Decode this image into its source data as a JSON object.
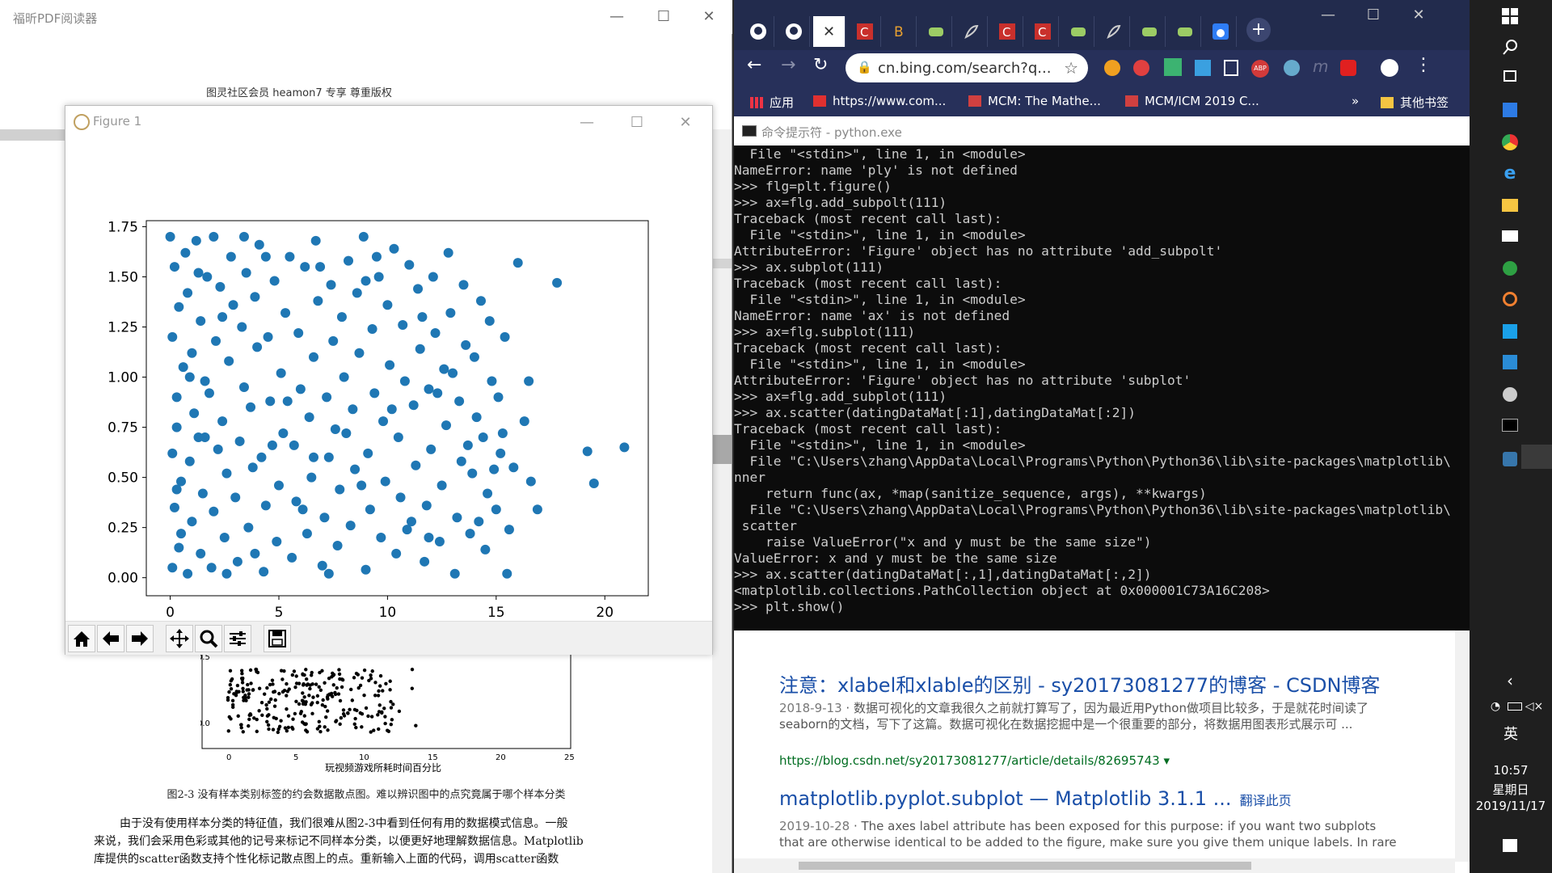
{
  "pdf": {
    "window_title": "福昕PDF阅读器",
    "page_header": "图灵社区会员 heamon7 专享 尊重版权",
    "figure_caption": "图2-3  没有样本类别标签的约会数据散点图。难以辨识图中的点究竟属于哪个样本分类",
    "body_lines": [
      "由于没有使用样本分类的特征值，我们很难从图2-3中看到任何有用的数据模式信息。一般",
      "来说，我们会采用色彩或其他的记号来标记不同样本分类，以便更好地理解数据信息。Matplotlib",
      "库提供的scatter函数支持个性化标记散点图上的点。重新输入上面的代码，调用scatter函数"
    ],
    "book_plot": {
      "ytick_labels": [
        "0.5",
        "0.0"
      ],
      "xtick_labels": [
        "0",
        "5",
        "10",
        "15",
        "20",
        "25"
      ],
      "xlabel": "玩视频游戏所耗时间百分比"
    }
  },
  "figure_window": {
    "title": "Figure 1",
    "toolbar": [
      "home-icon",
      "back-icon",
      "forward-icon",
      "pan-icon",
      "zoom-icon",
      "configure-icon",
      "save-icon"
    ]
  },
  "chart_data": {
    "type": "scatter",
    "color": "#1f77b4",
    "xlim": [
      -1.1,
      22
    ],
    "ylim": [
      -0.09,
      1.78
    ],
    "xticks": [
      0,
      5,
      10,
      15,
      20
    ],
    "yticks": [
      0.0,
      0.25,
      0.5,
      0.75,
      1.0,
      1.25,
      1.5,
      1.75
    ],
    "xtick_labels": [
      "0",
      "5",
      "10",
      "15",
      "20"
    ],
    "ytick_labels": [
      "0.00",
      "0.25",
      "0.50",
      "0.75",
      "1.00",
      "1.25",
      "1.50",
      "1.75"
    ],
    "points": [
      [
        0.1,
        0.05
      ],
      [
        0.2,
        0.35
      ],
      [
        0.1,
        0.62
      ],
      [
        0.3,
        0.9
      ],
      [
        0.1,
        1.2
      ],
      [
        0.2,
        1.55
      ],
      [
        0.0,
        1.7
      ],
      [
        0.4,
        0.15
      ],
      [
        0.5,
        0.48
      ],
      [
        0.3,
        0.75
      ],
      [
        0.6,
        1.05
      ],
      [
        0.4,
        1.35
      ],
      [
        0.7,
        1.62
      ],
      [
        0.8,
        0.02
      ],
      [
        1.0,
        0.28
      ],
      [
        0.9,
        0.58
      ],
      [
        1.1,
        0.82
      ],
      [
        1.0,
        1.12
      ],
      [
        0.8,
        1.42
      ],
      [
        1.2,
        1.68
      ],
      [
        1.4,
        0.12
      ],
      [
        1.5,
        0.42
      ],
      [
        1.3,
        0.7
      ],
      [
        1.6,
        0.98
      ],
      [
        1.4,
        1.28
      ],
      [
        1.7,
        1.5
      ],
      [
        1.9,
        0.05
      ],
      [
        2.0,
        0.33
      ],
      [
        2.2,
        0.64
      ],
      [
        1.8,
        0.92
      ],
      [
        2.1,
        1.18
      ],
      [
        2.3,
        1.45
      ],
      [
        2.0,
        1.7
      ],
      [
        2.5,
        0.2
      ],
      [
        2.6,
        0.52
      ],
      [
        2.4,
        0.78
      ],
      [
        2.7,
        1.08
      ],
      [
        2.9,
        1.36
      ],
      [
        2.8,
        1.6
      ],
      [
        3.1,
        0.08
      ],
      [
        3.0,
        0.4
      ],
      [
        3.2,
        0.68
      ],
      [
        3.4,
        0.95
      ],
      [
        3.3,
        1.25
      ],
      [
        3.5,
        1.52
      ],
      [
        3.6,
        0.25
      ],
      [
        3.8,
        0.55
      ],
      [
        3.7,
        0.85
      ],
      [
        4.0,
        1.15
      ],
      [
        3.9,
        1.4
      ],
      [
        4.1,
        1.66
      ],
      [
        4.3,
        0.03
      ],
      [
        4.4,
        0.36
      ],
      [
        4.2,
        0.6
      ],
      [
        4.6,
        0.88
      ],
      [
        4.5,
        1.2
      ],
      [
        4.8,
        1.48
      ],
      [
        4.9,
        0.18
      ],
      [
        5.0,
        0.46
      ],
      [
        5.2,
        0.72
      ],
      [
        5.1,
        1.02
      ],
      [
        5.3,
        1.32
      ],
      [
        5.5,
        1.6
      ],
      [
        5.6,
        0.1
      ],
      [
        5.8,
        0.38
      ],
      [
        5.7,
        0.66
      ],
      [
        6.0,
        0.94
      ],
      [
        5.9,
        1.22
      ],
      [
        6.2,
        1.55
      ],
      [
        6.3,
        0.22
      ],
      [
        6.5,
        0.5
      ],
      [
        6.4,
        0.8
      ],
      [
        6.6,
        1.1
      ],
      [
        6.8,
        1.38
      ],
      [
        6.7,
        1.68
      ],
      [
        7.0,
        0.06
      ],
      [
        7.1,
        0.3
      ],
      [
        7.3,
        0.6
      ],
      [
        7.2,
        0.9
      ],
      [
        7.5,
        1.18
      ],
      [
        7.4,
        1.46
      ],
      [
        7.7,
        0.16
      ],
      [
        7.8,
        0.44
      ],
      [
        7.6,
        0.74
      ],
      [
        8.0,
        1.0
      ],
      [
        7.9,
        1.3
      ],
      [
        8.2,
        1.58
      ],
      [
        8.3,
        0.26
      ],
      [
        8.5,
        0.54
      ],
      [
        8.4,
        0.84
      ],
      [
        8.7,
        1.12
      ],
      [
        8.6,
        1.42
      ],
      [
        8.9,
        1.7
      ],
      [
        9.0,
        0.04
      ],
      [
        9.2,
        0.34
      ],
      [
        9.1,
        0.62
      ],
      [
        9.4,
        0.92
      ],
      [
        9.3,
        1.24
      ],
      [
        9.6,
        1.5
      ],
      [
        9.7,
        0.2
      ],
      [
        9.9,
        0.48
      ],
      [
        9.8,
        0.78
      ],
      [
        10.1,
        1.06
      ],
      [
        10.0,
        1.36
      ],
      [
        10.3,
        1.64
      ],
      [
        10.4,
        0.12
      ],
      [
        10.6,
        0.4
      ],
      [
        10.5,
        0.7
      ],
      [
        10.8,
        0.98
      ],
      [
        10.7,
        1.26
      ],
      [
        11.0,
        1.56
      ],
      [
        11.1,
        0.28
      ],
      [
        11.3,
        0.56
      ],
      [
        11.2,
        0.86
      ],
      [
        11.5,
        1.14
      ],
      [
        11.4,
        1.44
      ],
      [
        11.7,
        0.08
      ],
      [
        11.8,
        0.36
      ],
      [
        12.0,
        0.64
      ],
      [
        11.9,
        0.94
      ],
      [
        12.2,
        1.22
      ],
      [
        12.1,
        1.5
      ],
      [
        12.4,
        0.18
      ],
      [
        12.5,
        0.46
      ],
      [
        12.7,
        0.76
      ],
      [
        12.6,
        1.04
      ],
      [
        12.9,
        1.32
      ],
      [
        12.8,
        1.62
      ],
      [
        13.1,
        0.02
      ],
      [
        13.2,
        0.3
      ],
      [
        13.4,
        0.58
      ],
      [
        13.3,
        0.88
      ],
      [
        13.6,
        1.16
      ],
      [
        13.5,
        1.46
      ],
      [
        13.8,
        0.22
      ],
      [
        13.9,
        0.52
      ],
      [
        14.1,
        0.8
      ],
      [
        14.0,
        1.1
      ],
      [
        14.3,
        1.38
      ],
      [
        14.5,
        0.14
      ],
      [
        14.6,
        0.42
      ],
      [
        14.4,
        0.7
      ],
      [
        14.8,
        0.98
      ],
      [
        14.7,
        1.28
      ],
      [
        15.0,
        0.34
      ],
      [
        15.2,
        0.62
      ],
      [
        15.1,
        0.9
      ],
      [
        15.4,
        1.2
      ],
      [
        15.6,
        0.24
      ],
      [
        15.5,
        0.02
      ],
      [
        15.8,
        0.55
      ],
      [
        16.0,
        1.57
      ],
      [
        16.3,
        0.78
      ],
      [
        16.5,
        0.98
      ],
      [
        16.6,
        0.48
      ],
      [
        16.9,
        0.34
      ],
      [
        17.8,
        1.47
      ],
      [
        19.5,
        0.47
      ],
      [
        19.2,
        0.63
      ],
      [
        20.9,
        0.65
      ],
      [
        0.5,
        0.22
      ],
      [
        1.3,
        1.52
      ],
      [
        2.6,
        0.02
      ],
      [
        3.4,
        1.7
      ],
      [
        4.7,
        0.66
      ],
      [
        6.1,
        0.34
      ],
      [
        6.9,
        1.55
      ],
      [
        8.1,
        0.72
      ],
      [
        9.5,
        1.6
      ],
      [
        10.9,
        0.24
      ],
      [
        12.3,
        0.92
      ],
      [
        13.7,
        0.66
      ],
      [
        14.9,
        0.54
      ],
      [
        3.9,
        0.12
      ],
      [
        5.4,
        0.88
      ],
      [
        7.3,
        0.02
      ],
      [
        8.8,
        0.46
      ],
      [
        10.2,
        0.84
      ],
      [
        11.6,
        1.3
      ],
      [
        13.0,
        1.02
      ],
      [
        2.4,
        1.3
      ],
      [
        4.4,
        1.6
      ],
      [
        6.6,
        0.6
      ],
      [
        9.0,
        1.48
      ],
      [
        11.9,
        0.2
      ],
      [
        14.2,
        0.28
      ],
      [
        15.3,
        0.72
      ],
      [
        1.6,
        0.7
      ],
      [
        0.9,
        1.0
      ],
      [
        0.3,
        0.44
      ]
    ]
  },
  "browser": {
    "address": "cn.bing.com/search?q...",
    "bookmarks": {
      "apps": "应用",
      "b1": "https://www.com...",
      "b2": "MCM: The Mathe...",
      "b3": "MCM/ICM 2019 C...",
      "more": "»",
      "others": "其他书签"
    },
    "cmd_title": "命令提示符 - python.exe",
    "cmd_lines": [
      "  File \"<stdin>\", line 1, in <module>",
      "NameError: name 'ply' is not defined",
      ">>> flg=plt.figure()",
      ">>> ax=flg.add_subpolt(111)",
      "Traceback (most recent call last):",
      "  File \"<stdin>\", line 1, in <module>",
      "AttributeError: 'Figure' object has no attribute 'add_subpolt'",
      ">>> ax.subplot(111)",
      "Traceback (most recent call last):",
      "  File \"<stdin>\", line 1, in <module>",
      "NameError: name 'ax' is not defined",
      ">>> ax=flg.subplot(111)",
      "Traceback (most recent call last):",
      "  File \"<stdin>\", line 1, in <module>",
      "AttributeError: 'Figure' object has no attribute 'subplot'",
      ">>> ax=flg.add_subplot(111)",
      ">>> ax.scatter(datingDataMat[:1],datingDataMat[:2])",
      "Traceback (most recent call last):",
      "  File \"<stdin>\", line 1, in <module>",
      "  File \"C:\\Users\\zhang\\AppData\\Local\\Programs\\Python\\Python36\\lib\\site-packages\\matplotlib\\",
      "nner",
      "    return func(ax, *map(sanitize_sequence, args), **kwargs)",
      "  File \"C:\\Users\\zhang\\AppData\\Local\\Programs\\Python\\Python36\\lib\\site-packages\\matplotlib\\",
      " scatter",
      "    raise ValueError(\"x and y must be the same size\")",
      "ValueError: x and y must be the same size",
      ">>> ax.scatter(datingDataMat[:,1],datingDataMat[:,2])",
      "<matplotlib.collections.PathCollection object at 0x000001C73A16C208>",
      ">>> plt.show()"
    ],
    "results": {
      "r1_title": "注意：xlabel和xlable的区别 - sy20173081277的博客 - CSDN博客",
      "r1_date": "2018-9-13",
      "r1_snippet": "数据可视化的文章我很久之前就打算写了，因为最近用Python做项目比较多，于是就花时间读了seaborn的文档，写下了这篇。数据可视化在数据挖掘中是一个很重要的部分，将数据用图表形式展示可 ...",
      "r1_url": "https://blog.csdn.net/sy20173081277/article/details/82695743",
      "r2_title": "matplotlib.pyplot.subplot — Matplotlib 3.1.1 ...",
      "r2_translate": "翻译此页",
      "r2_date": "2019-10-28",
      "r2_snippet": "The axes label attribute has been exposed for this purpose: if you want two subplots that are otherwise identical to be added to the figure, make sure you give them unique labels. In rare"
    }
  },
  "taskbar": {
    "ime": "英",
    "time": "10:57",
    "weekday": "星期日",
    "date": "2019/11/17"
  }
}
